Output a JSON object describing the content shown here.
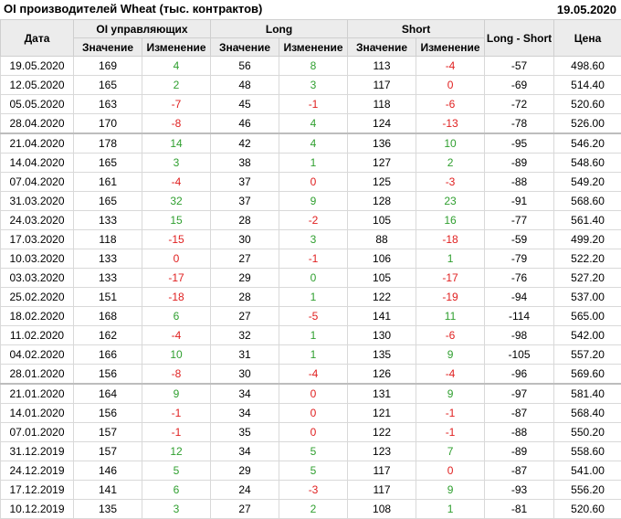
{
  "header": {
    "title": "OI производителей Wheat (тыс. контрактов)",
    "date": "19.05.2020"
  },
  "columns": {
    "date": "Дата",
    "oi_group": "OI управляющих",
    "long_group": "Long",
    "short_group": "Short",
    "long_short": "Long - Short",
    "price": "Цена",
    "value": "Значение",
    "change": "Изменение"
  },
  "colors": {
    "positive": "#2f9f2f",
    "negative": "#e02020"
  },
  "rows": [
    {
      "date": "19.05.2020",
      "oi": "169",
      "oi_ch": "4",
      "oi_s": "pos",
      "lg": "56",
      "lg_ch": "8",
      "lg_s": "pos",
      "sh": "113",
      "sh_ch": "-4",
      "sh_s": "neg",
      "ls": "-57",
      "price": "498.60",
      "sep": false
    },
    {
      "date": "12.05.2020",
      "oi": "165",
      "oi_ch": "2",
      "oi_s": "pos",
      "lg": "48",
      "lg_ch": "3",
      "lg_s": "pos",
      "sh": "117",
      "sh_ch": "0",
      "sh_s": "neg",
      "ls": "-69",
      "price": "514.40",
      "sep": false
    },
    {
      "date": "05.05.2020",
      "oi": "163",
      "oi_ch": "-7",
      "oi_s": "neg",
      "lg": "45",
      "lg_ch": "-1",
      "lg_s": "neg",
      "sh": "118",
      "sh_ch": "-6",
      "sh_s": "neg",
      "ls": "-72",
      "price": "520.60",
      "sep": false
    },
    {
      "date": "28.04.2020",
      "oi": "170",
      "oi_ch": "-8",
      "oi_s": "neg",
      "lg": "46",
      "lg_ch": "4",
      "lg_s": "pos",
      "sh": "124",
      "sh_ch": "-13",
      "sh_s": "neg",
      "ls": "-78",
      "price": "526.00",
      "sep": false
    },
    {
      "date": "21.04.2020",
      "oi": "178",
      "oi_ch": "14",
      "oi_s": "pos",
      "lg": "42",
      "lg_ch": "4",
      "lg_s": "pos",
      "sh": "136",
      "sh_ch": "10",
      "sh_s": "pos",
      "ls": "-95",
      "price": "546.20",
      "sep": true
    },
    {
      "date": "14.04.2020",
      "oi": "165",
      "oi_ch": "3",
      "oi_s": "pos",
      "lg": "38",
      "lg_ch": "1",
      "lg_s": "pos",
      "sh": "127",
      "sh_ch": "2",
      "sh_s": "pos",
      "ls": "-89",
      "price": "548.60",
      "sep": false
    },
    {
      "date": "07.04.2020",
      "oi": "161",
      "oi_ch": "-4",
      "oi_s": "neg",
      "lg": "37",
      "lg_ch": "0",
      "lg_s": "neg",
      "sh": "125",
      "sh_ch": "-3",
      "sh_s": "neg",
      "ls": "-88",
      "price": "549.20",
      "sep": false
    },
    {
      "date": "31.03.2020",
      "oi": "165",
      "oi_ch": "32",
      "oi_s": "pos",
      "lg": "37",
      "lg_ch": "9",
      "lg_s": "pos",
      "sh": "128",
      "sh_ch": "23",
      "sh_s": "pos",
      "ls": "-91",
      "price": "568.60",
      "sep": false
    },
    {
      "date": "24.03.2020",
      "oi": "133",
      "oi_ch": "15",
      "oi_s": "pos",
      "lg": "28",
      "lg_ch": "-2",
      "lg_s": "neg",
      "sh": "105",
      "sh_ch": "16",
      "sh_s": "pos",
      "ls": "-77",
      "price": "561.40",
      "sep": false
    },
    {
      "date": "17.03.2020",
      "oi": "118",
      "oi_ch": "-15",
      "oi_s": "neg",
      "lg": "30",
      "lg_ch": "3",
      "lg_s": "pos",
      "sh": "88",
      "sh_ch": "-18",
      "sh_s": "neg",
      "ls": "-59",
      "price": "499.20",
      "sep": false
    },
    {
      "date": "10.03.2020",
      "oi": "133",
      "oi_ch": "0",
      "oi_s": "neg",
      "lg": "27",
      "lg_ch": "-1",
      "lg_s": "neg",
      "sh": "106",
      "sh_ch": "1",
      "sh_s": "pos",
      "ls": "-79",
      "price": "522.20",
      "sep": false
    },
    {
      "date": "03.03.2020",
      "oi": "133",
      "oi_ch": "-17",
      "oi_s": "neg",
      "lg": "29",
      "lg_ch": "0",
      "lg_s": "pos",
      "sh": "105",
      "sh_ch": "-17",
      "sh_s": "neg",
      "ls": "-76",
      "price": "527.20",
      "sep": false
    },
    {
      "date": "25.02.2020",
      "oi": "151",
      "oi_ch": "-18",
      "oi_s": "neg",
      "lg": "28",
      "lg_ch": "1",
      "lg_s": "pos",
      "sh": "122",
      "sh_ch": "-19",
      "sh_s": "neg",
      "ls": "-94",
      "price": "537.00",
      "sep": false
    },
    {
      "date": "18.02.2020",
      "oi": "168",
      "oi_ch": "6",
      "oi_s": "pos",
      "lg": "27",
      "lg_ch": "-5",
      "lg_s": "neg",
      "sh": "141",
      "sh_ch": "11",
      "sh_s": "pos",
      "ls": "-114",
      "price": "565.00",
      "sep": false
    },
    {
      "date": "11.02.2020",
      "oi": "162",
      "oi_ch": "-4",
      "oi_s": "neg",
      "lg": "32",
      "lg_ch": "1",
      "lg_s": "pos",
      "sh": "130",
      "sh_ch": "-6",
      "sh_s": "neg",
      "ls": "-98",
      "price": "542.00",
      "sep": false
    },
    {
      "date": "04.02.2020",
      "oi": "166",
      "oi_ch": "10",
      "oi_s": "pos",
      "lg": "31",
      "lg_ch": "1",
      "lg_s": "pos",
      "sh": "135",
      "sh_ch": "9",
      "sh_s": "pos",
      "ls": "-105",
      "price": "557.20",
      "sep": false
    },
    {
      "date": "28.01.2020",
      "oi": "156",
      "oi_ch": "-8",
      "oi_s": "neg",
      "lg": "30",
      "lg_ch": "-4",
      "lg_s": "neg",
      "sh": "126",
      "sh_ch": "-4",
      "sh_s": "neg",
      "ls": "-96",
      "price": "569.60",
      "sep": false
    },
    {
      "date": "21.01.2020",
      "oi": "164",
      "oi_ch": "9",
      "oi_s": "pos",
      "lg": "34",
      "lg_ch": "0",
      "lg_s": "neg",
      "sh": "131",
      "sh_ch": "9",
      "sh_s": "pos",
      "ls": "-97",
      "price": "581.40",
      "sep": true
    },
    {
      "date": "14.01.2020",
      "oi": "156",
      "oi_ch": "-1",
      "oi_s": "neg",
      "lg": "34",
      "lg_ch": "0",
      "lg_s": "neg",
      "sh": "121",
      "sh_ch": "-1",
      "sh_s": "neg",
      "ls": "-87",
      "price": "568.40",
      "sep": false
    },
    {
      "date": "07.01.2020",
      "oi": "157",
      "oi_ch": "-1",
      "oi_s": "neg",
      "lg": "35",
      "lg_ch": "0",
      "lg_s": "neg",
      "sh": "122",
      "sh_ch": "-1",
      "sh_s": "neg",
      "ls": "-88",
      "price": "550.20",
      "sep": false
    },
    {
      "date": "31.12.2019",
      "oi": "157",
      "oi_ch": "12",
      "oi_s": "pos",
      "lg": "34",
      "lg_ch": "5",
      "lg_s": "pos",
      "sh": "123",
      "sh_ch": "7",
      "sh_s": "pos",
      "ls": "-89",
      "price": "558.60",
      "sep": false
    },
    {
      "date": "24.12.2019",
      "oi": "146",
      "oi_ch": "5",
      "oi_s": "pos",
      "lg": "29",
      "lg_ch": "5",
      "lg_s": "pos",
      "sh": "117",
      "sh_ch": "0",
      "sh_s": "neg",
      "ls": "-87",
      "price": "541.00",
      "sep": false
    },
    {
      "date": "17.12.2019",
      "oi": "141",
      "oi_ch": "6",
      "oi_s": "pos",
      "lg": "24",
      "lg_ch": "-3",
      "lg_s": "neg",
      "sh": "117",
      "sh_ch": "9",
      "sh_s": "pos",
      "ls": "-93",
      "price": "556.20",
      "sep": false
    },
    {
      "date": "10.12.2019",
      "oi": "135",
      "oi_ch": "3",
      "oi_s": "pos",
      "lg": "27",
      "lg_ch": "2",
      "lg_s": "pos",
      "sh": "108",
      "sh_ch": "1",
      "sh_s": "pos",
      "ls": "-81",
      "price": "520.60",
      "sep": false
    }
  ]
}
